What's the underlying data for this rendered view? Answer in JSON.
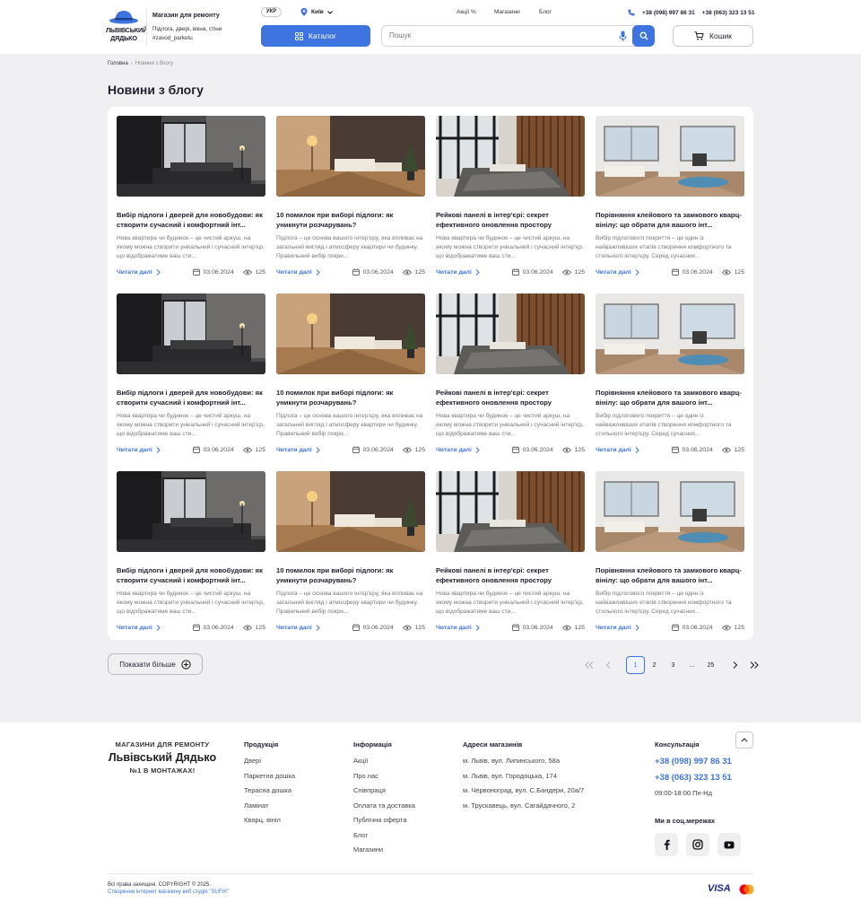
{
  "header": {
    "logo_text": "ЛЬВІВСЬКИЙ ДЯДЬКО",
    "tagline_title": "Магазин для ремонту",
    "tagline_sub": "Підлога, двері, вікна, стіни #zavod_parketu",
    "lang": "УКР",
    "city": "Київ",
    "nav": [
      "Акції %",
      "Магазини",
      "Блог"
    ],
    "phone1": "+38 (098) 997 86 31",
    "phone2": "+38 (063) 323 13 51",
    "catalog_label": "Каталог",
    "search_placeholder": "Пошук",
    "cart_label": "Кошик"
  },
  "breadcrumb": {
    "home": "Головна",
    "current": "Новини з блогу"
  },
  "page_title": "Новини з блогу",
  "articles": [
    {
      "title": "Вибір підлоги і дверей для новобудови: як створити сучасний і комфортний інт...",
      "desc": "Нова квартира чи будинок – це чистий аркуш, на якому можна створити унікальний і сучасний інтер'єр, що відображатиме ваш сти...",
      "more": "Читати далі",
      "date": "03.06.2024",
      "views": "125",
      "image": "dark-bedroom"
    },
    {
      "title": "10 помилок при виборі підлоги: як уникнути розчарувань?",
      "desc": "Підлога – це основа вашого інтер'єру, яка впливає на загальний вигляд і атмосферу квартири чи будинку. Правильний вибір покри...",
      "more": "Читати далі",
      "date": "03.06.2024",
      "views": "125",
      "image": "living-room-lamp"
    },
    {
      "title": "Рейкові панелі в інтер'єрі: секрет ефективного оновлення простору",
      "desc": "Нова квартира чи будинок – це чистий аркуш, на якому можна створити унікальний і сучасний інтер'єр, що відображатиме ваш сти...",
      "more": "Читати далі",
      "date": "03.06.2024",
      "views": "125",
      "image": "slat-panel-bedroom"
    },
    {
      "title": "Порівняння клейового та замкового кварц-вінілу: що обрати для вашого інт...",
      "desc": "Вибір підлогового покриття – це один із найважливіших етапів створення комфортного та стильного інтер'єру. Серед сучасних...",
      "more": "Читати далі",
      "date": "03.06.2024",
      "views": "125",
      "image": "bright-living-room"
    },
    {
      "title": "Вибір підлоги і дверей для новобудови: як створити сучасний і комфортний інт...",
      "desc": "Нова квартира чи будинок – це чистий аркуш, на якому можна створити унікальний і сучасний інтер'єр, що відображатиме ваш сти...",
      "more": "Читати далі",
      "date": "03.06.2024",
      "views": "125",
      "image": "dark-bedroom"
    },
    {
      "title": "10 помилок при виборі підлоги: як уникнути розчарувань?",
      "desc": "Підлога – це основа вашого інтер'єру, яка впливає на загальний вигляд і атмосферу квартири чи будинку. Правильний вибір покри...",
      "more": "Читати далі",
      "date": "03.06.2024",
      "views": "125",
      "image": "living-room-lamp"
    },
    {
      "title": "Рейкові панелі в інтер'єрі: секрет ефективного оновлення простору",
      "desc": "Нова квартира чи будинок – це чистий аркуш, на якому можна створити унікальний і сучасний інтер'єр, що відображатиме ваш сти...",
      "more": "Читати далі",
      "date": "03.06.2024",
      "views": "125",
      "image": "slat-panel-bedroom"
    },
    {
      "title": "Порівняння клейового та замкового кварц-вінілу: що обрати для вашого інт...",
      "desc": "Вибір підлогового покриття – це один із найважливіших етапів створення комфортного та стильного інтер'єру. Серед сучасних...",
      "more": "Читати далі",
      "date": "03.06.2024",
      "views": "125",
      "image": "bright-living-room"
    },
    {
      "title": "Вибір підлоги і дверей для новобудови: як створити сучасний і комфортний інт...",
      "desc": "Нова квартира чи будинок – це чистий аркуш, на якому можна створити унікальний і сучасний інтер'єр, що відображатиме ваш сти...",
      "more": "Читати далі",
      "date": "03.06.2024",
      "views": "125",
      "image": "dark-bedroom"
    },
    {
      "title": "10 помилок при виборі підлоги: як уникнути розчарувань?",
      "desc": "Підлога – це основа вашого інтер'єру, яка впливає на загальний вигляд і атмосферу квартири чи будинку. Правильний вибір покри...",
      "more": "Читати далі",
      "date": "03.06.2024",
      "views": "125",
      "image": "living-room-lamp"
    },
    {
      "title": "Рейкові панелі в інтер'єрі: секрет ефективного оновлення простору",
      "desc": "Нова квартира чи будинок – це чистий аркуш, на якому можна створити унікальний і сучасний інтер'єр, що відображатиме ваш сти...",
      "more": "Читати далі",
      "date": "03.06.2024",
      "views": "125",
      "image": "slat-panel-bedroom"
    },
    {
      "title": "Порівняння клейового та замкового кварц-вінілу: що обрати для вашого інт...",
      "desc": "Вибір підлогового покриття – це один із найважливіших етапів створення комфортного та стильного інтер'єру. Серед сучасних...",
      "more": "Читати далі",
      "date": "03.06.2024",
      "views": "125",
      "image": "bright-living-room"
    }
  ],
  "show_more_label": "Показати більше",
  "pagination": {
    "pages": [
      "1",
      "2",
      "3",
      "...",
      "25"
    ],
    "current": "1"
  },
  "footer": {
    "logo_top": "МАГАЗИНИ ДЛЯ РЕМОНТУ",
    "logo_name": "Львівський Дядько",
    "logo_bottom": "№1 В МОНТАЖАХ!",
    "products_title": "Продукція",
    "products": [
      "Двері",
      "Паркетна дошка",
      "Терасна дошка",
      "Ламінат",
      "Кварц. вініл"
    ],
    "info_title": "Інформація",
    "info": [
      "Акції",
      "Про нас",
      "Співпраця",
      "Оплата та доставка",
      "Публічна оферта",
      "Блог",
      "Магазини"
    ],
    "addresses_title": "Адреси магазинів",
    "addresses": [
      "м. Львів, вул. Липинського, 58а",
      "м. Львів, вул. Городоцька, 174",
      "м. Червоноград, вул. С.Бандери, 20а/7",
      "м. Трускавець, вул. Сагайдачного, 2"
    ],
    "consult_title": "Консультація",
    "phone1": "+38 (098) 997 86 31",
    "phone2": "+38 (063) 323 13 51",
    "hours": "09:00-18:00 Пн-Нд",
    "social_title": "Ми в соц.мережах",
    "copyright": "Всі права захищені. COPYRIGHT © 2025.",
    "studio": "Створення інтернет магазину веб студія \"SUFIX\"",
    "visa": "VISA"
  },
  "colors": {
    "accent": "#3d74e0",
    "page_bg": "#f0f0f3",
    "text": "#1f1f2e"
  }
}
